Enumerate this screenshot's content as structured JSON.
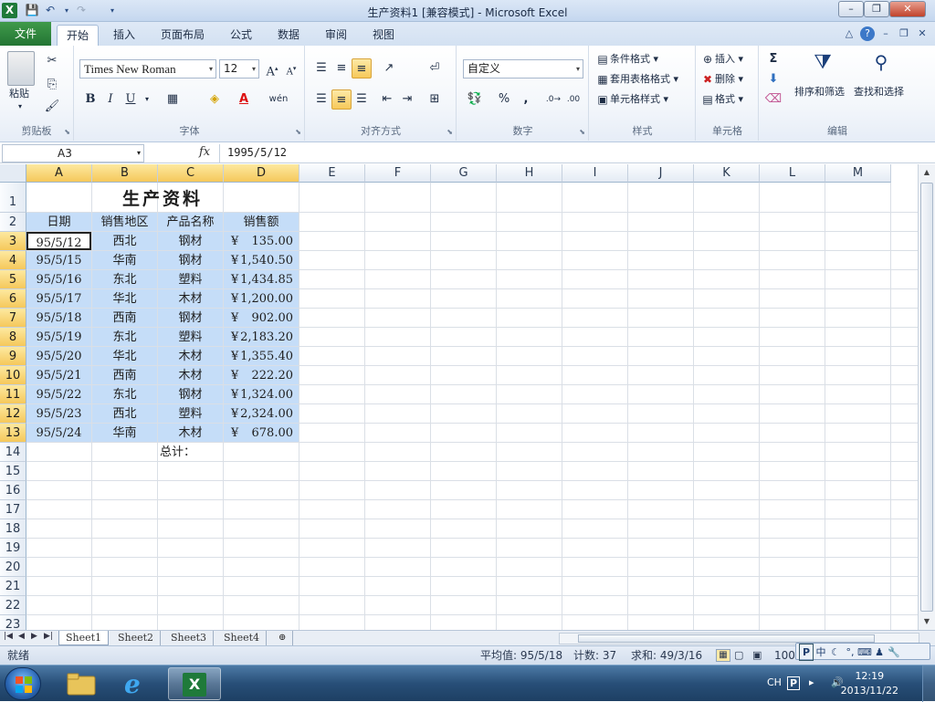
{
  "window": {
    "title": "生产资料1  [兼容模式]  -  Microsoft Excel",
    "app_icon": "X",
    "controls": {
      "minimize": "–",
      "restore": "❐",
      "close": "✕"
    }
  },
  "ribbon_tabs": [
    "文件",
    "开始",
    "插入",
    "页面布局",
    "公式",
    "数据",
    "审阅",
    "视图"
  ],
  "ribbon": {
    "clipboard": {
      "label": "剪贴板",
      "paste": "粘贴"
    },
    "font": {
      "label": "字体",
      "name": "Times New Roman",
      "size": "12"
    },
    "alignment": {
      "label": "对齐方式"
    },
    "number": {
      "label": "数字",
      "format": "自定义"
    },
    "styles": {
      "label": "样式",
      "conditional": "条件格式",
      "table": "套用表格格式",
      "cell_styles": "单元格样式"
    },
    "cells": {
      "label": "单元格",
      "insert": "插入",
      "delete": "删除",
      "format": "格式"
    },
    "editing": {
      "label": "编辑",
      "sort": "排序和筛选",
      "find": "查找和选择"
    }
  },
  "formula_bar": {
    "name_box": "A3",
    "fx": "fx",
    "formula": "1995/5/12"
  },
  "columns": [
    "A",
    "B",
    "C",
    "D",
    "E",
    "F",
    "G",
    "H",
    "I",
    "J",
    "K",
    "L",
    "M"
  ],
  "rows": [
    "1",
    "2",
    "3",
    "4",
    "5",
    "6",
    "7",
    "8",
    "9",
    "10",
    "11",
    "12",
    "13",
    "14",
    "15",
    "16",
    "17",
    "18",
    "19",
    "20",
    "21",
    "22",
    "23"
  ],
  "sheet": {
    "title": "生产资料",
    "headers": [
      "日期",
      "销售地区",
      "产品名称",
      "销售额"
    ],
    "currency_symbol": "¥",
    "data": [
      [
        "95/5/12",
        "西北",
        "钢材",
        "135.00"
      ],
      [
        "95/5/15",
        "华南",
        "钢材",
        "1,540.50"
      ],
      [
        "95/5/16",
        "东北",
        "塑料",
        "1,434.85"
      ],
      [
        "95/5/17",
        "华北",
        "木材",
        "1,200.00"
      ],
      [
        "95/5/18",
        "西南",
        "钢材",
        "902.00"
      ],
      [
        "95/5/19",
        "东北",
        "塑料",
        "2,183.20"
      ],
      [
        "95/5/20",
        "华北",
        "木材",
        "1,355.40"
      ],
      [
        "95/5/21",
        "西南",
        "木材",
        "222.20"
      ],
      [
        "95/5/22",
        "东北",
        "钢材",
        "1,324.00"
      ],
      [
        "95/5/23",
        "西北",
        "塑料",
        "2,324.00"
      ],
      [
        "95/5/24",
        "华南",
        "木材",
        "678.00"
      ]
    ],
    "total_label": "总计："
  },
  "sheet_tabs": [
    "Sheet1",
    "Sheet2",
    "Sheet3",
    "Sheet4"
  ],
  "status": {
    "ready": "就绪",
    "average": "平均值: 95/5/18",
    "count": "计数: 37",
    "sum": "求和: 49/3/16",
    "zoom": "100"
  },
  "ime": [
    "中",
    "☾",
    "°,",
    "⌨",
    "♟",
    "🔧"
  ],
  "tray": {
    "lang": "CH",
    "time": "12:19",
    "date": "2013/11/22"
  }
}
